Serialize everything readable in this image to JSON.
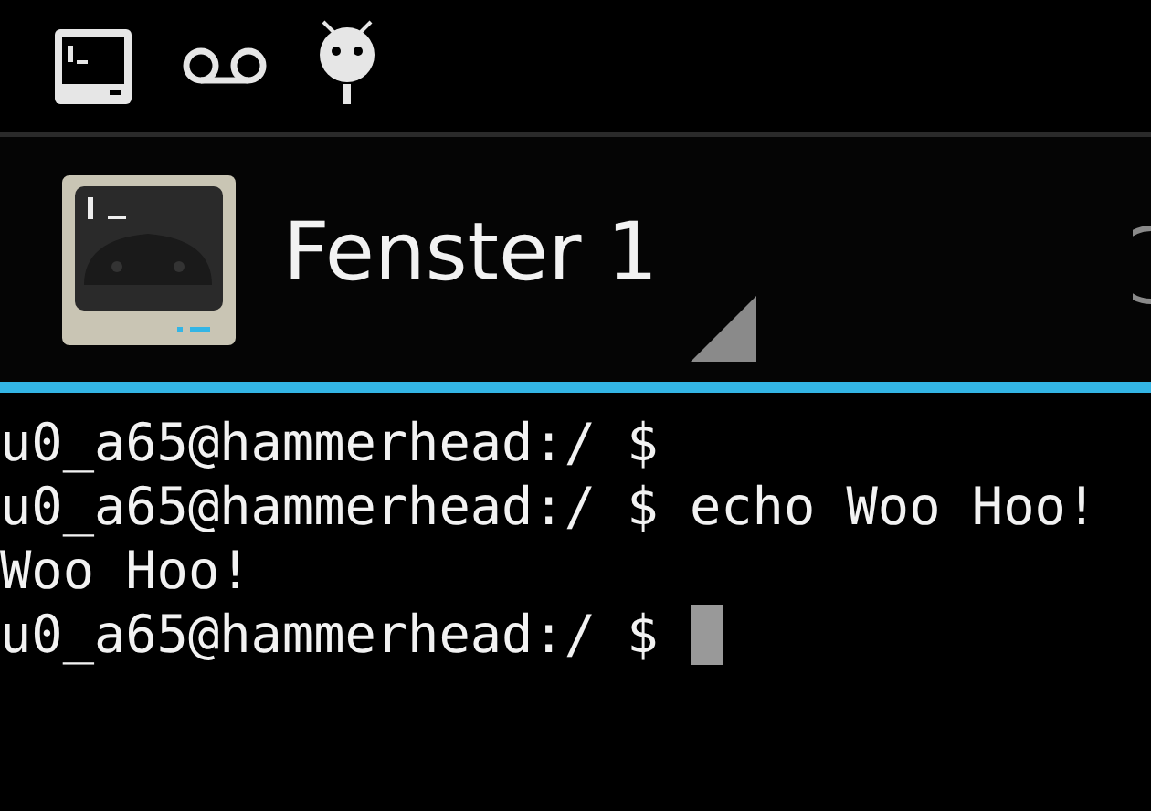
{
  "action_bar": {
    "title": "Fenster 1"
  },
  "terminal": {
    "lines": [
      "u0_a65@hammerhead:/ $",
      "u0_a65@hammerhead:/ $ echo Woo Hoo!",
      "Woo Hoo!",
      "u0_a65@hammerhead:/ $ "
    ],
    "cursor_visible": true
  }
}
